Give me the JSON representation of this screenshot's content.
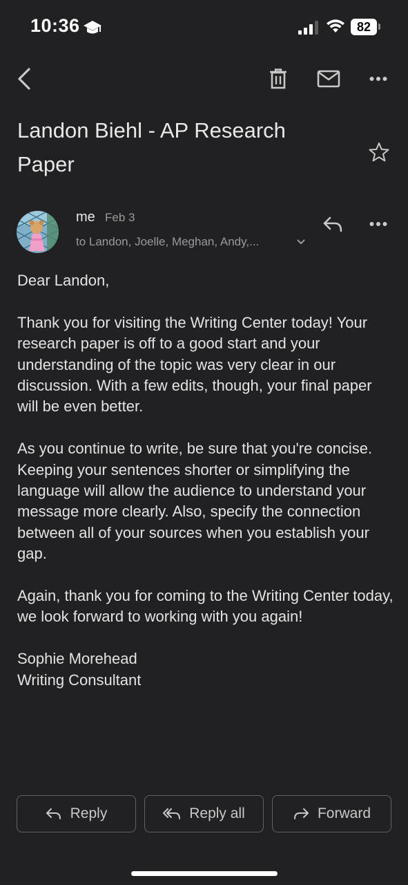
{
  "status_bar": {
    "time": "10:36",
    "battery": "82"
  },
  "toolbar": {
    "back_icon": "chevron-left-icon",
    "delete_icon": "trash-icon",
    "mark_unread_icon": "mail-icon",
    "more_icon": "more-horizontal-icon"
  },
  "email": {
    "subject": "Landon Biehl - AP Research Paper",
    "sender": "me",
    "date": "Feb 3",
    "recipients": "to Landon, Joelle, Meghan, Andy,...",
    "body": [
      "Dear Landon,",
      "Thank you for visiting the Writing Center today! Your research paper is off to a good start and your understanding of the topic was very clear in our discussion. With a few edits, though, your final paper will be even better.",
      "As you continue to write, be sure that you're concise. Keeping your sentences shorter or simplifying the language will allow the audience to understand your message more clearly. Also, specify the connection between all of your sources when you establish your gap.",
      "Again, thank you for coming to the Writing Center today, we look forward to working with you again!"
    ],
    "signature_name": "Sophie Morehead",
    "signature_title": "Writing Consultant"
  },
  "actions": {
    "reply": "Reply",
    "reply_all": "Reply all",
    "forward": "Forward"
  },
  "colors": {
    "background": "#212124",
    "text": "#e3e3e3",
    "secondary_text": "#9a9a9a",
    "button_border": "#5f6368"
  }
}
